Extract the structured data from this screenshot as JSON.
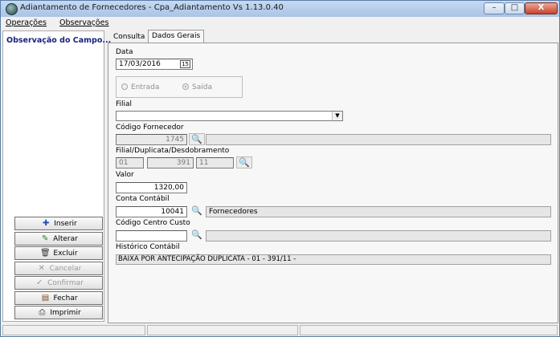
{
  "window": {
    "title": "Adiantamento de Fornecedores - Cpa_Adiantamento Vs 1.13.0.40",
    "buttons": {
      "minimize": "–",
      "maximize": "□",
      "close": "X"
    }
  },
  "menu": {
    "items": [
      "Operações",
      "Observações"
    ]
  },
  "left_panel": {
    "title": "Observação do Campo...",
    "buttons": [
      {
        "label": "Inserir",
        "icon": "insert-icon",
        "glyph": "✚",
        "enabled": true
      },
      {
        "label": "Alterar",
        "icon": "edit-icon",
        "glyph": "✎",
        "enabled": true
      },
      {
        "label": "Excluir",
        "icon": "trash-icon",
        "glyph": "🗑",
        "enabled": true
      },
      {
        "label": "Cancelar",
        "icon": "cancel-icon",
        "glyph": "✕",
        "enabled": false
      },
      {
        "label": "Confirmar",
        "icon": "check-icon",
        "glyph": "✓",
        "enabled": false
      },
      {
        "label": "Fechar",
        "icon": "close-door-icon",
        "glyph": "▤",
        "enabled": true
      },
      {
        "label": "Imprimir",
        "icon": "printer-icon",
        "glyph": "⎙",
        "enabled": true
      }
    ]
  },
  "tabs": [
    {
      "label": "Consulta",
      "selected": false
    },
    {
      "label": "Dados Gerais",
      "selected": true
    }
  ],
  "form": {
    "data_label": "Data",
    "data_value": "17/03/2016",
    "calendar_glyph": "15",
    "radio_entrada": "Entrada",
    "radio_saida": "Saída",
    "filial_label": "Filial",
    "filial_value": "",
    "codigo_fornecedor_label": "Código Fornecedor",
    "codigo_fornecedor_value": "1745",
    "fornecedor_nome": "",
    "fdd_label": "Filial/Duplicata/Desdobramento",
    "fdd_filial": "01",
    "fdd_duplicata": "391",
    "fdd_desdobramento": "11",
    "valor_label": "Valor",
    "valor_value": "1320,00",
    "conta_contabil_label": "Conta Contábil",
    "conta_contabil_value": "10041",
    "conta_contabil_desc": "Fornecedores",
    "centro_custo_label": "Código Centro Custo",
    "centro_custo_value": "",
    "centro_custo_desc": "",
    "historico_label": "Histórico Contábil",
    "historico_value": "BAIXA POR ANTECIPAÇÃO DUPLICATA - 01 - 391/11 -"
  },
  "colors": {
    "left_title": "#1a237e",
    "titlebar": "#b8cfec"
  }
}
